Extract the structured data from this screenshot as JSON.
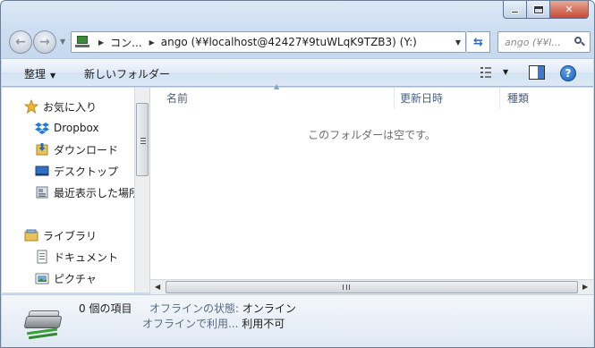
{
  "window": {
    "caption": {
      "minimize": "minimize",
      "maximize": "maximize",
      "close": "✕"
    }
  },
  "nav": {
    "address_segments": [
      "コン...",
      "ango (¥¥localhost@42427¥9tuWLqK9TZB3) (Y:)"
    ],
    "search_placeholder": "ango (¥¥l..."
  },
  "toolbar": {
    "organize_label": "整理",
    "new_folder_label": "新しいフォルダー"
  },
  "sidebar": {
    "items": [
      {
        "label": "お気に入り",
        "icon": "star-icon"
      },
      {
        "label": "Dropbox",
        "icon": "dropbox-icon"
      },
      {
        "label": "ダウンロード",
        "icon": "downloads-folder-icon"
      },
      {
        "label": "デスクトップ",
        "icon": "desktop-icon"
      },
      {
        "label": "最近表示した場所",
        "icon": "recent-places-icon"
      },
      {
        "label": "ライブラリ",
        "icon": "libraries-icon"
      },
      {
        "label": "ドキュメント",
        "icon": "documents-icon"
      },
      {
        "label": "ピクチャ",
        "icon": "pictures-icon"
      }
    ]
  },
  "content": {
    "columns": [
      "名前",
      "更新日時",
      "種類"
    ],
    "empty_message": "このフォルダーは空です。"
  },
  "details": {
    "item_count": "0 個の項目",
    "offline_status_label": "オフラインの状態:",
    "offline_status_value": "オンライン",
    "offline_use_label": "オフラインで利用...",
    "offline_use_value": "利用不可"
  },
  "colors": {
    "accent": "#2a6abf",
    "close_button": "#c74a33",
    "header_text": "#4c607a"
  }
}
